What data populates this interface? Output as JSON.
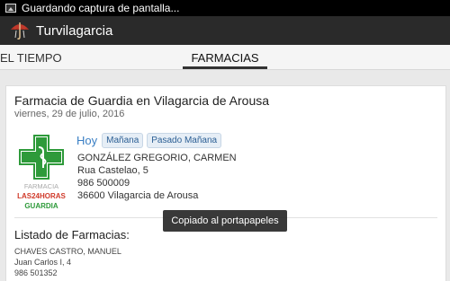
{
  "status_bar": {
    "notification": "Guardando captura de pantalla..."
  },
  "app": {
    "title": "Turvilagarcia"
  },
  "tabs": [
    {
      "label": "EL TIEMPO",
      "active": false
    },
    {
      "label": "FARMACIAS",
      "active": true
    }
  ],
  "card": {
    "title": "Farmacia de Guardia en Vilagarcia de Arousa",
    "date": "viernes, 29 de julio, 2016",
    "logo": {
      "top_text": "FARMACIA",
      "mid_text": "LAS24HORAS",
      "bottom_text": "GUARDIA"
    },
    "day_tabs": {
      "today": "Hoy",
      "tomorrow": "Mañana",
      "day_after": "Pasado Mañana"
    },
    "pharmacy": {
      "name": "GONZÁLEZ GREGORIO, CARMEN",
      "street": "Rua Castelao, 5",
      "phone": "986 500009",
      "city": "36600 Vilagarcia de Arousa"
    },
    "list": {
      "title": "Listado de Farmacias:",
      "items": [
        {
          "name": "CHAVES CASTRO, MANUEL",
          "street": "Juan Carlos I, 4",
          "phone": "986 501352"
        }
      ]
    }
  },
  "toast": {
    "message": "Copiado al portapapeles"
  },
  "colors": {
    "accent": "#3a7fc4",
    "logo_green": "#2e9a3a",
    "logo_red": "#d03a2a"
  }
}
